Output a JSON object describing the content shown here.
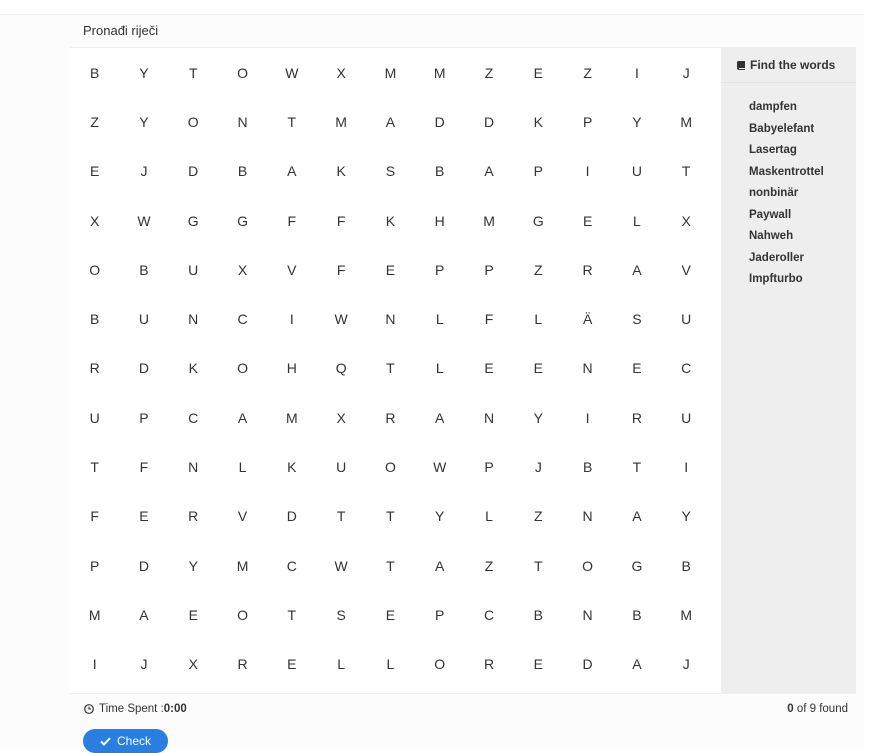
{
  "title": "Pronađi riječi",
  "grid": [
    [
      "B",
      "Y",
      "T",
      "O",
      "W",
      "X",
      "M",
      "M",
      "Z",
      "E",
      "Z",
      "I",
      "J"
    ],
    [
      "Z",
      "Y",
      "O",
      "N",
      "T",
      "M",
      "A",
      "D",
      "D",
      "K",
      "P",
      "Y",
      "M"
    ],
    [
      "E",
      "J",
      "D",
      "B",
      "A",
      "K",
      "S",
      "B",
      "A",
      "P",
      "I",
      "U",
      "T"
    ],
    [
      "X",
      "W",
      "G",
      "G",
      "F",
      "F",
      "K",
      "H",
      "M",
      "G",
      "E",
      "L",
      "X"
    ],
    [
      "O",
      "B",
      "U",
      "X",
      "V",
      "F",
      "E",
      "P",
      "P",
      "Z",
      "R",
      "A",
      "V"
    ],
    [
      "B",
      "U",
      "N",
      "C",
      "I",
      "W",
      "N",
      "L",
      "F",
      "L",
      "Ä",
      "S",
      "U"
    ],
    [
      "R",
      "D",
      "K",
      "O",
      "H",
      "Q",
      "T",
      "L",
      "E",
      "E",
      "N",
      "E",
      "C"
    ],
    [
      "U",
      "P",
      "C",
      "A",
      "M",
      "X",
      "R",
      "A",
      "N",
      "Y",
      "I",
      "R",
      "U"
    ],
    [
      "T",
      "F",
      "N",
      "L",
      "K",
      "U",
      "O",
      "W",
      "P",
      "J",
      "B",
      "T",
      "I"
    ],
    [
      "F",
      "E",
      "R",
      "V",
      "D",
      "T",
      "T",
      "Y",
      "L",
      "Z",
      "N",
      "A",
      "Y"
    ],
    [
      "P",
      "D",
      "Y",
      "M",
      "C",
      "W",
      "T",
      "A",
      "Z",
      "T",
      "O",
      "G",
      "B"
    ],
    [
      "M",
      "A",
      "E",
      "O",
      "T",
      "S",
      "E",
      "P",
      "C",
      "B",
      "N",
      "B",
      "M"
    ],
    [
      "I",
      "J",
      "X",
      "R",
      "E",
      "L",
      "L",
      "O",
      "R",
      "E",
      "D",
      "A",
      "J"
    ]
  ],
  "sidebar": {
    "heading": "Find the words",
    "icon": "book-icon",
    "words": [
      "dampfen",
      "Babyelefant",
      "Lasertag",
      "Maskentrottel",
      "nonbinär",
      "Paywall",
      "Nahweh",
      "Jaderoller",
      "Impfturbo"
    ]
  },
  "footer": {
    "time_label": "Time Spent : ",
    "time_value": "0:00",
    "found_count": "0",
    "found_suffix": " of 9 found",
    "clock_icon": "clock-icon"
  },
  "check_button": {
    "label": "Check",
    "icon": "check-icon",
    "color": "#2a7ee0"
  }
}
